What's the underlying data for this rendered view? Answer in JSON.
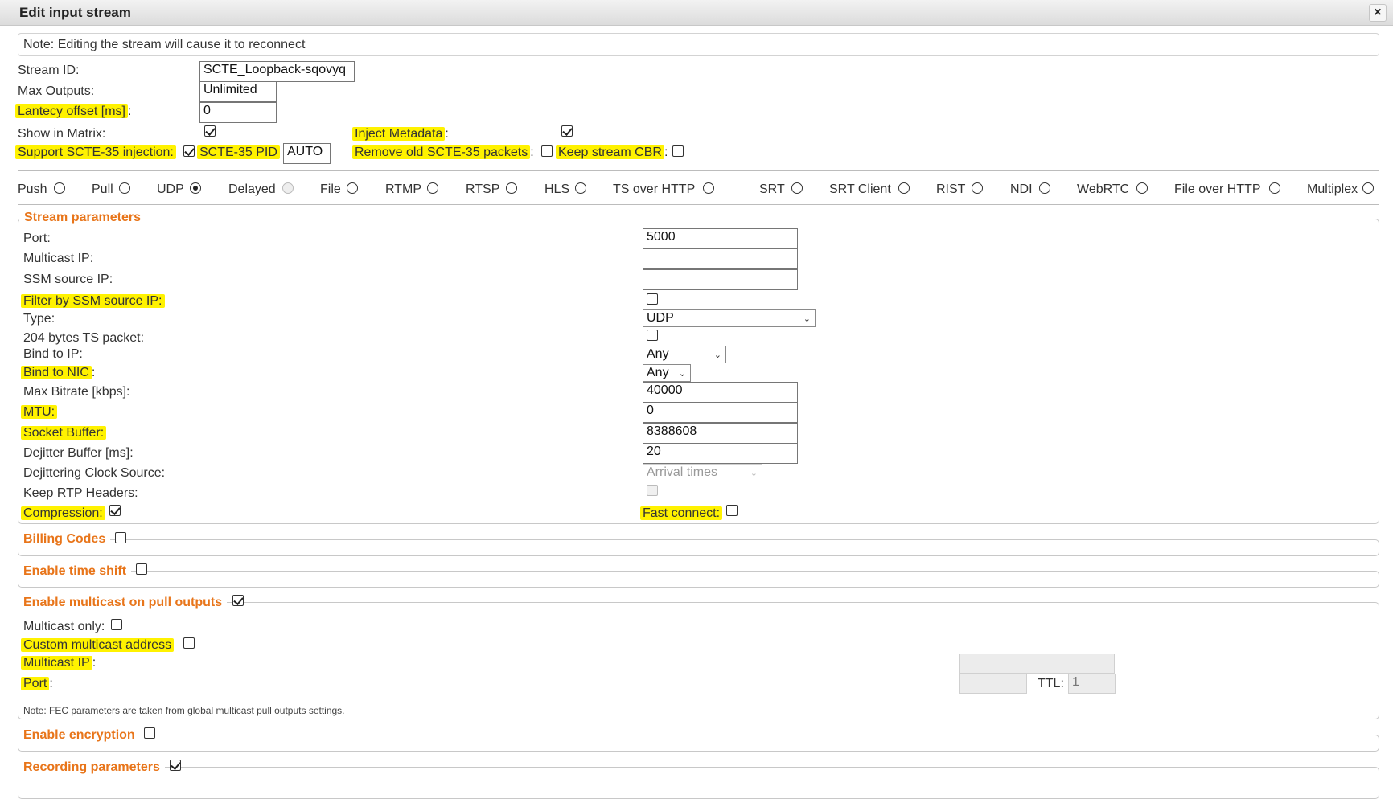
{
  "dialog": {
    "title": "Edit input stream",
    "close_icon": "×"
  },
  "note": "Note: Editing the stream will cause it to reconnect",
  "general": {
    "stream_id_label": "Stream ID:",
    "stream_id_value": "SCTE_Loopback-sqovyq",
    "max_outputs_label": "Max Outputs:",
    "max_outputs_value": "Unlimited",
    "latency_label": "Lantecy offset [ms]",
    "latency_value": "0",
    "show_matrix_label": "Show in Matrix:",
    "inject_metadata_label": "Inject Metadata",
    "support_scte_label": "Support SCTE-35 injection:",
    "scte_pid_label": "SCTE-35 PID",
    "scte_pid_value": "AUTO",
    "remove_old_label": "Remove old SCTE-35 packets",
    "keep_cbr_label": "Keep stream CBR",
    "colon": ":"
  },
  "protocols": [
    {
      "label": "Push",
      "state": "off"
    },
    {
      "label": "Pull",
      "state": "off"
    },
    {
      "label": "UDP",
      "state": "on"
    },
    {
      "label": "Delayed",
      "state": "disabled"
    },
    {
      "label": "File",
      "state": "off"
    },
    {
      "label": "RTMP",
      "state": "off"
    },
    {
      "label": "RTSP",
      "state": "off"
    },
    {
      "label": "HLS",
      "state": "off"
    },
    {
      "label": "TS over HTTP",
      "state": "off"
    },
    {
      "label": "SRT",
      "state": "off"
    },
    {
      "label": "SRT Client",
      "state": "off"
    },
    {
      "label": "RIST",
      "state": "off"
    },
    {
      "label": "NDI",
      "state": "off"
    },
    {
      "label": "WebRTC",
      "state": "off"
    },
    {
      "label": "File over HTTP",
      "state": "off"
    },
    {
      "label": "Multiplex",
      "state": "off"
    }
  ],
  "stream_params": {
    "legend": "Stream parameters",
    "port_label": "Port:",
    "port_value": "5000",
    "multicast_ip_label": "Multicast IP:",
    "multicast_ip_value": "",
    "ssm_label": "SSM source IP:",
    "ssm_value": "",
    "filter_ssm_label": "Filter by SSM source IP:",
    "type_label": "Type:",
    "type_value": "UDP",
    "ts204_label": "204 bytes TS packet:",
    "bind_ip_label": "Bind to IP:",
    "bind_ip_value": "Any",
    "bind_nic_label": "Bind to NIC",
    "bind_nic_value": "Any",
    "max_bitrate_label": "Max Bitrate [kbps]:",
    "max_bitrate_value": "40000",
    "mtu_label": "MTU:",
    "mtu_value": "0",
    "socket_buffer_label": "Socket Buffer:",
    "socket_buffer_value": "8388608",
    "dejitter_label": "Dejitter Buffer [ms]:",
    "dejitter_value": "20",
    "clock_label": "Dejittering Clock Source:",
    "clock_value": "Arrival times",
    "rtp_label": "Keep RTP Headers:",
    "compression_label": "Compression:",
    "fast_connect_label": "Fast connect:"
  },
  "billing": {
    "legend": "Billing Codes"
  },
  "timeshift": {
    "legend": "Enable time shift"
  },
  "multicast_pull": {
    "legend": "Enable multicast on pull outputs",
    "multicast_only_label": "Multicast only:",
    "custom_address_label": "Custom multicast address",
    "ip_label": "Multicast IP",
    "port_label": "Port",
    "ttl_label": "TTL:",
    "ttl_value": "1",
    "fec_note": "Note: FEC parameters are taken from global multicast pull outputs settings."
  },
  "encryption": {
    "legend": "Enable encryption"
  },
  "recording": {
    "legend": "Recording parameters"
  }
}
